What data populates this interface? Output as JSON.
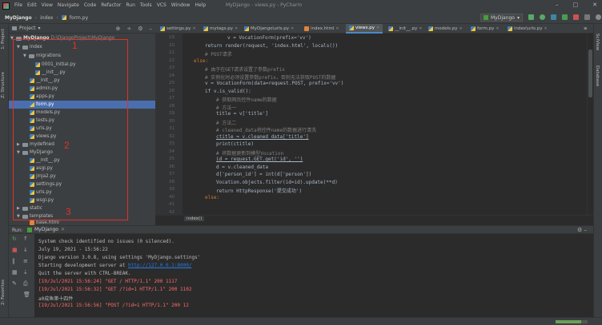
{
  "window": {
    "title": "MyDjango - views.py - PyCharm",
    "menus": [
      "File",
      "Edit",
      "View",
      "Navigate",
      "Code",
      "Refactor",
      "Run",
      "Tools",
      "VCS",
      "Window",
      "Help"
    ]
  },
  "breadcrumb": [
    "MyDjango",
    "index",
    "form.py"
  ],
  "run_config": "MyDjango",
  "left_strip": {
    "project_tab": "1: Project",
    "structure_tab": "Z: Structure",
    "favorites_tab": "2: Favorites"
  },
  "right_strip": {
    "scview_tab": "SciView",
    "database_tab": "Database"
  },
  "project": {
    "header": "Project",
    "root_name": "MyDjango",
    "root_path": "D:\\DjangoProject\\MyDjango",
    "items": [
      {
        "name": "index",
        "type": "folder"
      },
      {
        "name": "migrations",
        "type": "folder"
      },
      {
        "name": "0001_initial.py",
        "type": "py"
      },
      {
        "name": "__init__.py",
        "type": "py"
      },
      {
        "name": "__init__.py",
        "type": "py"
      },
      {
        "name": "admin.py",
        "type": "py"
      },
      {
        "name": "apps.py",
        "type": "py"
      },
      {
        "name": "form.py",
        "type": "py"
      },
      {
        "name": "models.py",
        "type": "py"
      },
      {
        "name": "tests.py",
        "type": "py"
      },
      {
        "name": "urls.py",
        "type": "py"
      },
      {
        "name": "views.py",
        "type": "py"
      },
      {
        "name": "mydefined",
        "type": "folder"
      },
      {
        "name": "MyDjango",
        "type": "folder"
      },
      {
        "name": "__init__.py",
        "type": "py"
      },
      {
        "name": "asgi.py",
        "type": "py"
      },
      {
        "name": "jinja2.py",
        "type": "py"
      },
      {
        "name": "settings.py",
        "type": "py"
      },
      {
        "name": "urls.py",
        "type": "py"
      },
      {
        "name": "wsgi.py",
        "type": "py"
      },
      {
        "name": "static",
        "type": "folder"
      },
      {
        "name": "templates",
        "type": "folder"
      },
      {
        "name": "base.html",
        "type": "html"
      }
    ],
    "annotations": [
      "1",
      "2",
      "3"
    ]
  },
  "tabs": [
    "settings.py",
    "mytags.py",
    "MyDjango\\urls.py",
    "index.html",
    "views.py",
    "__init__.py",
    "models.py",
    "form.py",
    "index\\urls.py"
  ],
  "active_tab": "views.py",
  "line_numbers": [
    "19",
    "20",
    "21",
    "22",
    "23",
    "24",
    "25",
    "26",
    "27",
    "28",
    "29",
    "30",
    "31",
    "32",
    "33",
    "34",
    "35",
    "36",
    "37",
    "38",
    "39",
    "40",
    "41",
    "42"
  ],
  "code": {
    "l19": "v = VocationForm(prefix='vv')",
    "l20": "return render(request, 'index.html', locals())",
    "l21": "# POST请求",
    "l22": "else:",
    "l23": "# 由于在GET请求设置了参数prefix",
    "l24": "# 实例化时必须设置参数prefix，否则无法获取POST的数据",
    "l25": "v = VocationForm(data=request.POST, prefix='vv')",
    "l26": "if v.is_valid():",
    "l27": "# 获取网页控件name的数据",
    "l28": "# 方法一",
    "l29": "title = v['title']",
    "l30": "# 方法二",
    "l31": "# cleaned_data将控件name的数据进行清洗",
    "l32": "ctitle = v.cleaned_data['title']",
    "l33": "print(ctitle)",
    "l34": "# 将数据更新到模型Vocation",
    "l35": "id = request.GET.get('id', '')",
    "l36": "d = v.cleaned_data",
    "l37": "d['person_id'] = int(d['person'])",
    "l38": "Vocation.objects.filter(id=id).update(**d)",
    "l39": "return HttpResponse('提交成功')",
    "l40": "else:"
  },
  "editor_crumb": "index()",
  "run": {
    "label": "Run:",
    "tab": "MyDjango",
    "lines": [
      "System check identified no issues (0 silenced).",
      "July 19, 2021 - 15:56:22",
      "Django version 3.0.8, using settings 'MyDjango.settings'",
      "Starting development server at ",
      "http://127.0.0.1:8000/",
      "Quit the server with CTRL-BREAK.",
      "[19/Jul/2021 15:56:24] \"GET / HTTP/1.1\" 200 1117",
      "[19/Jul/2021 15:56:32] \"GET /?id=1 HTTP/1.1\" 200 1102",
      "a0成鱼第十四件",
      "[19/Jul/2021 15:56:56] \"POST /?id=1 HTTP/1.1\" 200 12"
    ]
  },
  "status_progress": 0.8
}
